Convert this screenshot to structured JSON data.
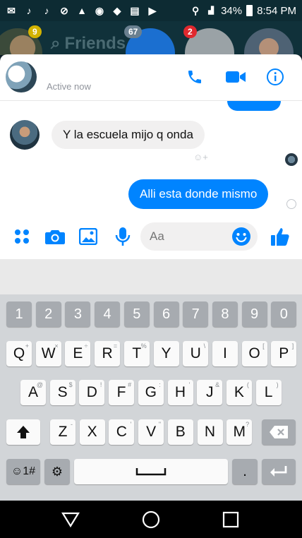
{
  "status_bar": {
    "icons": [
      "messenger-icon",
      "tiktok-icon",
      "tiktok-icon",
      "no-notifications-icon",
      "alert-icon",
      "chrome-icon",
      "app-icon",
      "news-icon",
      "youtube-icon"
    ],
    "battery": "34%",
    "time": "8:54 PM"
  },
  "background": {
    "friends_label": "Friends",
    "badge_friends": "9",
    "badge_video": "67",
    "badge_dismiss": "2"
  },
  "chat": {
    "status": "Active now",
    "messages": [
      {
        "from": "other",
        "text": "Y la escuela mijo q onda"
      },
      {
        "from": "me",
        "text": "Alli esta donde mismo"
      }
    ]
  },
  "composer": {
    "placeholder": "Aa"
  },
  "keyboard": {
    "number_row": [
      "1",
      "2",
      "3",
      "4",
      "5",
      "6",
      "7",
      "8",
      "9",
      "0"
    ],
    "row1": [
      "Q",
      "W",
      "E",
      "R",
      "T",
      "Y",
      "U",
      "I",
      "O",
      "P"
    ],
    "row1_hints": [
      "+",
      "×",
      "÷",
      "=",
      "%",
      "",
      "\\",
      "",
      "[",
      "]"
    ],
    "row2": [
      "A",
      "S",
      "D",
      "F",
      "G",
      "H",
      "J",
      "K",
      "L"
    ],
    "row2_hints": [
      "@",
      "$",
      "!",
      "#",
      ":",
      "'",
      "&",
      "(",
      ")"
    ],
    "row3": [
      "Z",
      "X",
      "C",
      "V",
      "B",
      "N",
      "M"
    ],
    "row3_hints": [
      "-",
      "",
      "'",
      "\"",
      "",
      "",
      "?"
    ],
    "symbols_key": "☺1#",
    "settings_key": "⚙",
    "period_key": "."
  },
  "accent_color": "#0084ff"
}
